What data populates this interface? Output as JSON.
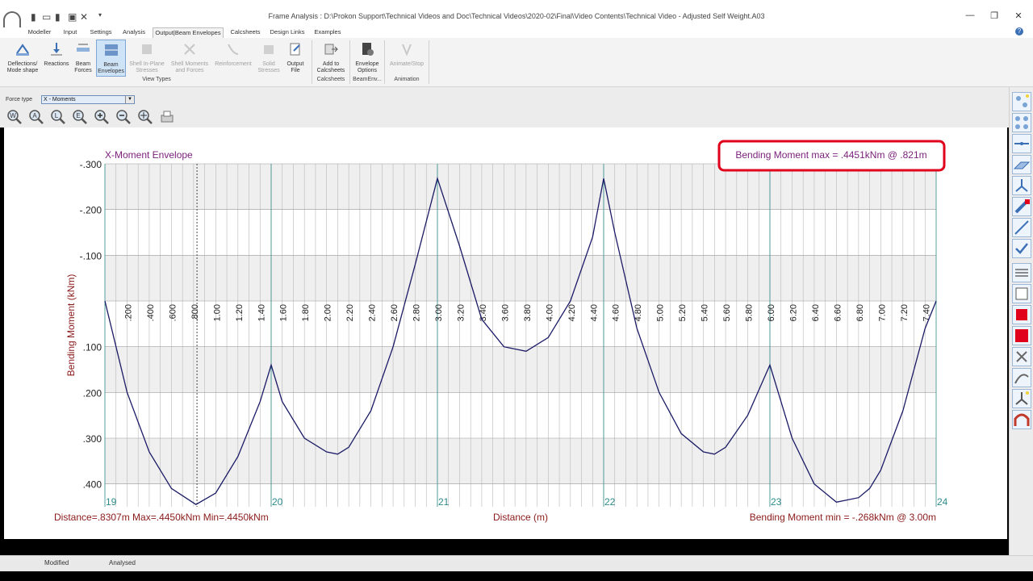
{
  "window": {
    "title": "Frame Analysis :  D:\\Prokon Support\\Technical Videos and Doc\\Technical Videos\\2020-02\\Final\\Video Contents\\Technical Video - Adjusted Self Weight.A03",
    "minimize": "—",
    "restore": "❐",
    "close": "✕"
  },
  "menu": {
    "tabs": [
      "Modeller",
      "Input",
      "Settings",
      "Analysis",
      "Output|Beam Envelopes",
      "Calcsheets",
      "Design Links",
      "Examples"
    ],
    "active_index": 4,
    "help": "?"
  },
  "ribbon": {
    "view_types": {
      "label": "View Types",
      "buttons": [
        {
          "line1": "Deflections/",
          "line2": "Mode shape",
          "icon": "deflection-icon"
        },
        {
          "line1": "Reactions",
          "line2": "",
          "icon": "reactions-icon"
        },
        {
          "line1": "Beam",
          "line2": "Forces",
          "icon": "beam-forces-icon"
        },
        {
          "line1": "Beam",
          "line2": "Envelopes",
          "icon": "beam-envelopes-icon"
        },
        {
          "line1": "Shell In-Plane",
          "line2": "Stresses",
          "icon": "shell-stress-icon"
        },
        {
          "line1": "Shell Moments",
          "line2": "and Forces",
          "icon": "shell-moments-icon"
        },
        {
          "line1": "Reinforcement",
          "line2": "",
          "icon": "reinforcement-icon"
        },
        {
          "line1": "Solid",
          "line2": "Stresses",
          "icon": "solid-stress-icon"
        },
        {
          "line1": "Output",
          "line2": "File",
          "icon": "output-file-icon"
        }
      ]
    },
    "calcsheets": {
      "label": "Calcsheets",
      "button": {
        "line1": "Add to",
        "line2": "Calcsheets",
        "icon": "add-calcsheet-icon"
      }
    },
    "beamenv": {
      "label": "BeamEnv...",
      "button": {
        "line1": "Envelope",
        "line2": "Options",
        "icon": "envelope-options-icon"
      }
    },
    "animation": {
      "label": "Animation",
      "button": {
        "line1": "Animate/Stop",
        "line2": "",
        "icon": "animate-icon"
      }
    }
  },
  "force": {
    "label": "Force type",
    "value": "X - Moments"
  },
  "zoom_tools": [
    "zoom-window-icon",
    "zoom-all-icon",
    "zoom-last-icon",
    "zoom-extents-icon",
    "zoom-in-icon",
    "zoom-out-icon",
    "pan-icon",
    "print-icon"
  ],
  "chart_info": {
    "max_box": "Bending Moment max = .4451kNm @ .821m",
    "min_text": "Bending Moment min = -.268kNm @ 3.00m",
    "cursor_text": "Distance=.8307m  Max=.4450kNm  Min=.4450kNm",
    "highlight_color": "#e0001b",
    "curve_color": "#1a1a66",
    "title_color": "#7a1f7a",
    "label_color": "#8b1a1a"
  },
  "chart_data": {
    "type": "line",
    "title": "X-Moment Envelope",
    "xlabel": "Distance (m)",
    "ylabel": "Bending Moment (kNm)",
    "y_inverted": true,
    "xlim": [
      0,
      7.5
    ],
    "ylim": [
      -0.3,
      0.45
    ],
    "y_ticks": [
      {
        "v": -0.3,
        "label": "-.300"
      },
      {
        "v": -0.2,
        "label": "-.200"
      },
      {
        "v": -0.1,
        "label": "-.100"
      },
      {
        "v": 0.1,
        "label": ".100"
      },
      {
        "v": 0.2,
        "label": ".200"
      },
      {
        "v": 0.3,
        "label": ".300"
      },
      {
        "v": 0.4,
        "label": ".400"
      }
    ],
    "x_tick_labels": [
      {
        "v": 0.2,
        "label": ".200"
      },
      {
        "v": 0.4,
        "label": ".400"
      },
      {
        "v": 0.6,
        "label": ".600"
      },
      {
        "v": 0.8,
        "label": ".800"
      },
      {
        "v": 1.0,
        "label": "1.00"
      },
      {
        "v": 1.2,
        "label": "1.20"
      },
      {
        "v": 1.4,
        "label": "1.40"
      },
      {
        "v": 1.6,
        "label": "1.60"
      },
      {
        "v": 1.8,
        "label": "1.80"
      },
      {
        "v": 2.0,
        "label": "2.00"
      },
      {
        "v": 2.2,
        "label": "2.20"
      },
      {
        "v": 2.4,
        "label": "2.40"
      },
      {
        "v": 2.6,
        "label": "2.60"
      },
      {
        "v": 2.8,
        "label": "2.80"
      },
      {
        "v": 3.0,
        "label": "3.00"
      },
      {
        "v": 3.2,
        "label": "3.20"
      },
      {
        "v": 3.4,
        "label": "3.40"
      },
      {
        "v": 3.6,
        "label": "3.60"
      },
      {
        "v": 3.8,
        "label": "3.80"
      },
      {
        "v": 4.0,
        "label": "4.00"
      },
      {
        "v": 4.2,
        "label": "4.20"
      },
      {
        "v": 4.4,
        "label": "4.40"
      },
      {
        "v": 4.6,
        "label": "4.60"
      },
      {
        "v": 4.8,
        "label": "4.80"
      },
      {
        "v": 5.0,
        "label": "5.00"
      },
      {
        "v": 5.2,
        "label": "5.20"
      },
      {
        "v": 5.4,
        "label": "5.40"
      },
      {
        "v": 5.6,
        "label": "5.60"
      },
      {
        "v": 5.8,
        "label": "5.80"
      },
      {
        "v": 6.0,
        "label": "6.00"
      },
      {
        "v": 6.2,
        "label": "6.20"
      },
      {
        "v": 6.4,
        "label": "6.40"
      },
      {
        "v": 6.6,
        "label": "6.60"
      },
      {
        "v": 6.8,
        "label": "6.80"
      },
      {
        "v": 7.0,
        "label": "7.00"
      },
      {
        "v": 7.2,
        "label": "7.20"
      },
      {
        "v": 7.4,
        "label": "7.40"
      }
    ],
    "nodes": [
      {
        "x": 0.0,
        "label": "19"
      },
      {
        "x": 1.5,
        "label": "20"
      },
      {
        "x": 3.0,
        "label": "21"
      },
      {
        "x": 4.5,
        "label": "22"
      },
      {
        "x": 6.0,
        "label": "23"
      },
      {
        "x": 7.5,
        "label": "24"
      }
    ],
    "cursor_x": 0.8307,
    "series": [
      {
        "x": [
          0.0,
          0.2,
          0.4,
          0.6,
          0.821,
          1.0,
          1.2,
          1.4,
          1.5,
          1.6,
          1.8,
          2.0,
          2.1,
          2.2,
          2.4,
          2.6,
          2.8,
          3.0,
          3.2,
          3.4,
          3.6,
          3.8,
          4.0,
          4.2,
          4.4,
          4.5,
          4.6,
          4.8,
          5.0,
          5.2,
          5.4,
          5.5,
          5.6,
          5.8,
          6.0,
          6.2,
          6.4,
          6.6,
          6.8,
          6.9,
          7.0,
          7.2,
          7.4,
          7.5
        ],
        "y": [
          0.0,
          0.2,
          0.33,
          0.41,
          0.4451,
          0.42,
          0.34,
          0.22,
          0.14,
          0.22,
          0.3,
          0.33,
          0.335,
          0.32,
          0.24,
          0.1,
          -0.08,
          -0.268,
          -0.12,
          0.04,
          0.1,
          0.11,
          0.08,
          0.0,
          -0.14,
          -0.268,
          -0.15,
          0.06,
          0.2,
          0.29,
          0.33,
          0.335,
          0.32,
          0.25,
          0.14,
          0.3,
          0.4,
          0.44,
          0.43,
          0.41,
          0.37,
          0.24,
          0.06,
          0.0
        ]
      }
    ]
  },
  "right_tools": [
    "node-icon",
    "select-nodes-icon",
    "member-icon",
    "shell-icon",
    "support-icon",
    "load-icon",
    "distributed-load-icon",
    "check-icon",
    "layers-icon",
    "frame-icon",
    "section-icon",
    "material-icon",
    "delete-icon",
    "spring-icon",
    "release-icon",
    "arch-icon"
  ],
  "status": {
    "left": "Modified",
    "right": "Analysed"
  }
}
